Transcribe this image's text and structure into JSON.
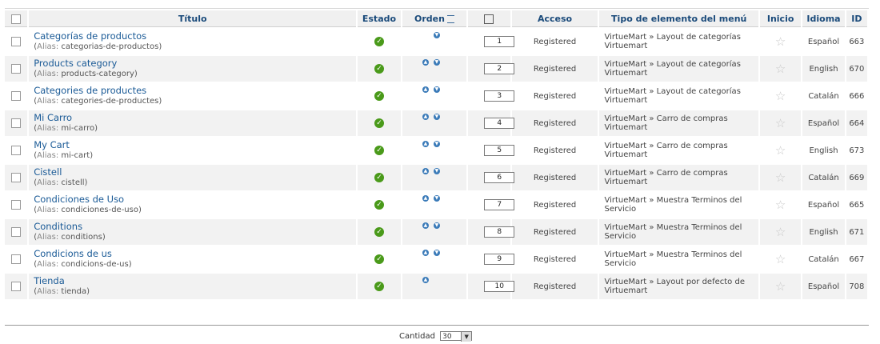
{
  "columns": {
    "titulo": "Título",
    "estado": "Estado",
    "orden": "Orden",
    "acceso": "Acceso",
    "tipo": "Tipo de elemento del menú",
    "inicio": "Inicio",
    "idioma": "Idioma",
    "id": "ID"
  },
  "alias_label": "Alias:",
  "rows": [
    {
      "title": "Categorías de productos",
      "alias": "categorias-de-productos",
      "order": "1",
      "access": "Registered",
      "type": "VirtueMart » Layout de categorías Virtuemart",
      "language": "Español",
      "id": "663",
      "up": false,
      "down": true
    },
    {
      "title": "Products category",
      "alias": "products-category",
      "order": "2",
      "access": "Registered",
      "type": "VirtueMart » Layout de categorías Virtuemart",
      "language": "English",
      "id": "670",
      "up": true,
      "down": true
    },
    {
      "title": "Categories de productes",
      "alias": "categories-de-productes",
      "order": "3",
      "access": "Registered",
      "type": "VirtueMart » Layout de categorías Virtuemart",
      "language": "Catalán",
      "id": "666",
      "up": true,
      "down": true
    },
    {
      "title": "Mi Carro",
      "alias": "mi-carro",
      "order": "4",
      "access": "Registered",
      "type": "VirtueMart » Carro de compras Virtuemart",
      "language": "Español",
      "id": "664",
      "up": true,
      "down": true
    },
    {
      "title": "My Cart",
      "alias": "mi-cart",
      "order": "5",
      "access": "Registered",
      "type": "VirtueMart » Carro de compras Virtuemart",
      "language": "English",
      "id": "673",
      "up": true,
      "down": true
    },
    {
      "title": "Cistell",
      "alias": "cistell",
      "order": "6",
      "access": "Registered",
      "type": "VirtueMart » Carro de compras Virtuemart",
      "language": "Catalán",
      "id": "669",
      "up": true,
      "down": true
    },
    {
      "title": "Condiciones de Uso",
      "alias": "condiciones-de-uso",
      "order": "7",
      "access": "Registered",
      "type": "VirtueMart » Muestra Terminos del Servicio",
      "language": "Español",
      "id": "665",
      "up": true,
      "down": true
    },
    {
      "title": "Conditions",
      "alias": "conditions",
      "order": "8",
      "access": "Registered",
      "type": "VirtueMart » Muestra Terminos del Servicio",
      "language": "English",
      "id": "671",
      "up": true,
      "down": true
    },
    {
      "title": "Condicions de us",
      "alias": "condicions-de-us",
      "order": "9",
      "access": "Registered",
      "type": "VirtueMart » Muestra Terminos del Servicio",
      "language": "Catalán",
      "id": "667",
      "up": true,
      "down": true
    },
    {
      "title": "Tienda",
      "alias": "tienda",
      "order": "10",
      "access": "Registered",
      "type": "VirtueMart » Layout por defecto de Virtuemart",
      "language": "Español",
      "id": "708",
      "up": true,
      "down": false
    }
  ],
  "footer": {
    "cantidad_label": "Cantidad",
    "cantidad_value": "30"
  },
  "colors": {
    "link": "#1a5a96",
    "header_text": "#1a4a7a",
    "published": "#4a9a1a",
    "arrow": "#3a7ab8"
  }
}
